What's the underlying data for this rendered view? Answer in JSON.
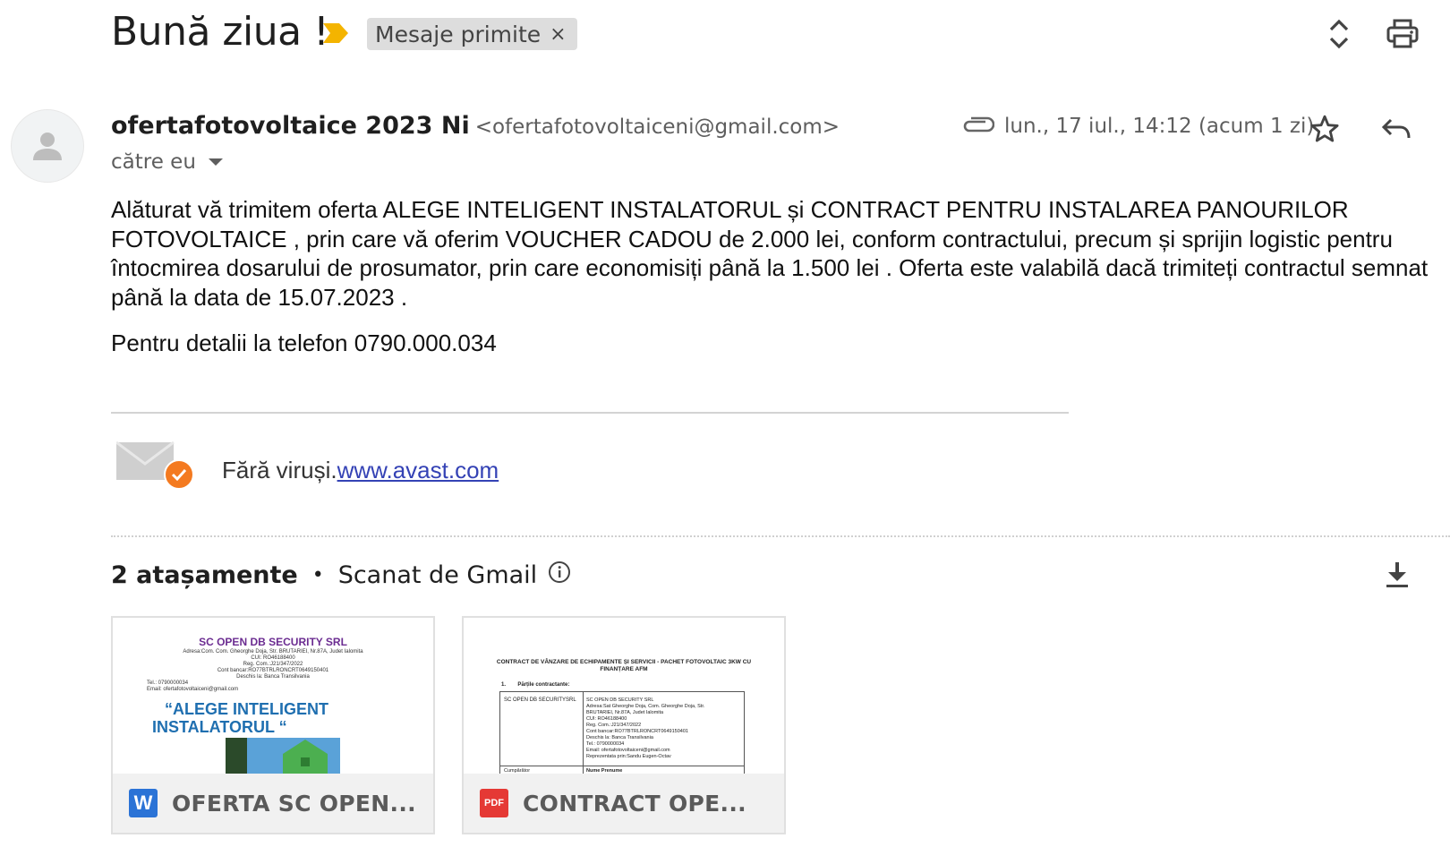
{
  "header": {
    "subject": "Bună ziua !",
    "label": "Mesaje primite",
    "label_close": "×"
  },
  "message": {
    "sender_name": "ofertafotovoltaice 2023 Ni",
    "sender_email": "<ofertafotovoltaiceni@gmail.com>",
    "to": "către eu",
    "date": "lun., 17 iul., 14:12 (acum 1 zi)",
    "body_lines": [
      "Alăturat vă trimitem oferta ALEGE INTELIGENT INSTALATORUL și CONTRACT PENTRU INSTALAREA PANOURILOR",
      "FOTOVOLTAICE , prin care vă oferim VOUCHER CADOU de 2.000 lei, conform contractului, precum și sprijin logistic pentru",
      "întocmirea dosarului de prosumator, prin care economisiți până la 1.500 lei .  Oferta este valabilă dacă trimiteți contractul semnat",
      "până la data de 15.07.2023 ."
    ],
    "phone_line": "Pentru detalii la telefon 0790.000.034",
    "avast_prefix": "Fără viruși.",
    "avast_link": "www.avast.com"
  },
  "attachments": {
    "count_label": "2 atașamente",
    "separator": "•",
    "scanned_label": "Scanat de Gmail",
    "files": [
      {
        "name": "OFERTA SC OPEN...",
        "type_icon": "W",
        "accent": "#1a73e8",
        "preview_company": "SC OPEN DB SECURITY SRL",
        "preview_addr": "Adresa:Com. Com. Gheorghe Doja, Str. BRUTARIEI, Nr.87A, Judet Ialomita",
        "preview_cui": "CUI: RO46188400",
        "preview_reg": "Reg. Com.:J21/347/2022",
        "preview_cont": "Cont bancar:RO77BTRLRONCRT0649150401",
        "preview_bank": "Deschis la: Banca Transilvania",
        "preview_tel": "Tel.: 0790000034",
        "preview_email": "Email: ofertafotovoltaiceni@gmail.com",
        "preview_headline_1": "“ALEGE INTELIGENT",
        "preview_headline_2": "INSTALATORUL “"
      },
      {
        "name": "CONTRACT OPE...",
        "type_icon": "PDF",
        "accent": "#ea4335",
        "preview_title_1": "CONTRACT DE VÂNZARE DE ECHIPAMENTE ȘI SERVICII - PACHET FOTOVOLTAIC 3KW CU",
        "preview_title_2": "FINANȚARE AFM",
        "preview_section": "1.        Părțile contractante:",
        "preview_left": "SC OPEN DB SECURITYSRL",
        "preview_r1": "SC OPEN DB SECURITY SRL",
        "preview_r2": "Adresa:Sat Gheorghe Doja, Com. Gheorghe Doja, Str.",
        "preview_r3": "BRUTARIEI, Nr.87A, Judet Ialomita",
        "preview_r4": "CUI: RO46188400",
        "preview_r5": "Reg. Com.:J21/347/2022",
        "preview_r6": "Cont bancar:RO77BTRLRONCRT0649150401",
        "preview_r7": "Deschis la: Banca Transilvania",
        "preview_r8": "Tel.: 0790000034",
        "preview_r9": "Email: ofertafotovoltaiceni@gmail.com",
        "preview_r10": "Reprezentata prin:Sandu Eugen-Octav",
        "preview_r11": "Cumpărător",
        "preview_r12": "Nume Prenume"
      }
    ]
  },
  "colors": {
    "importance": "#f4b400",
    "avast_badge": "#f47a20",
    "link": "#3442b5"
  },
  "icons": [
    "importance-marker-icon",
    "expand-collapse-icon",
    "print-icon",
    "avatar-icon",
    "paperclip-icon",
    "star-icon",
    "reply-icon",
    "envelope-check-icon",
    "info-icon",
    "download-icon"
  ]
}
